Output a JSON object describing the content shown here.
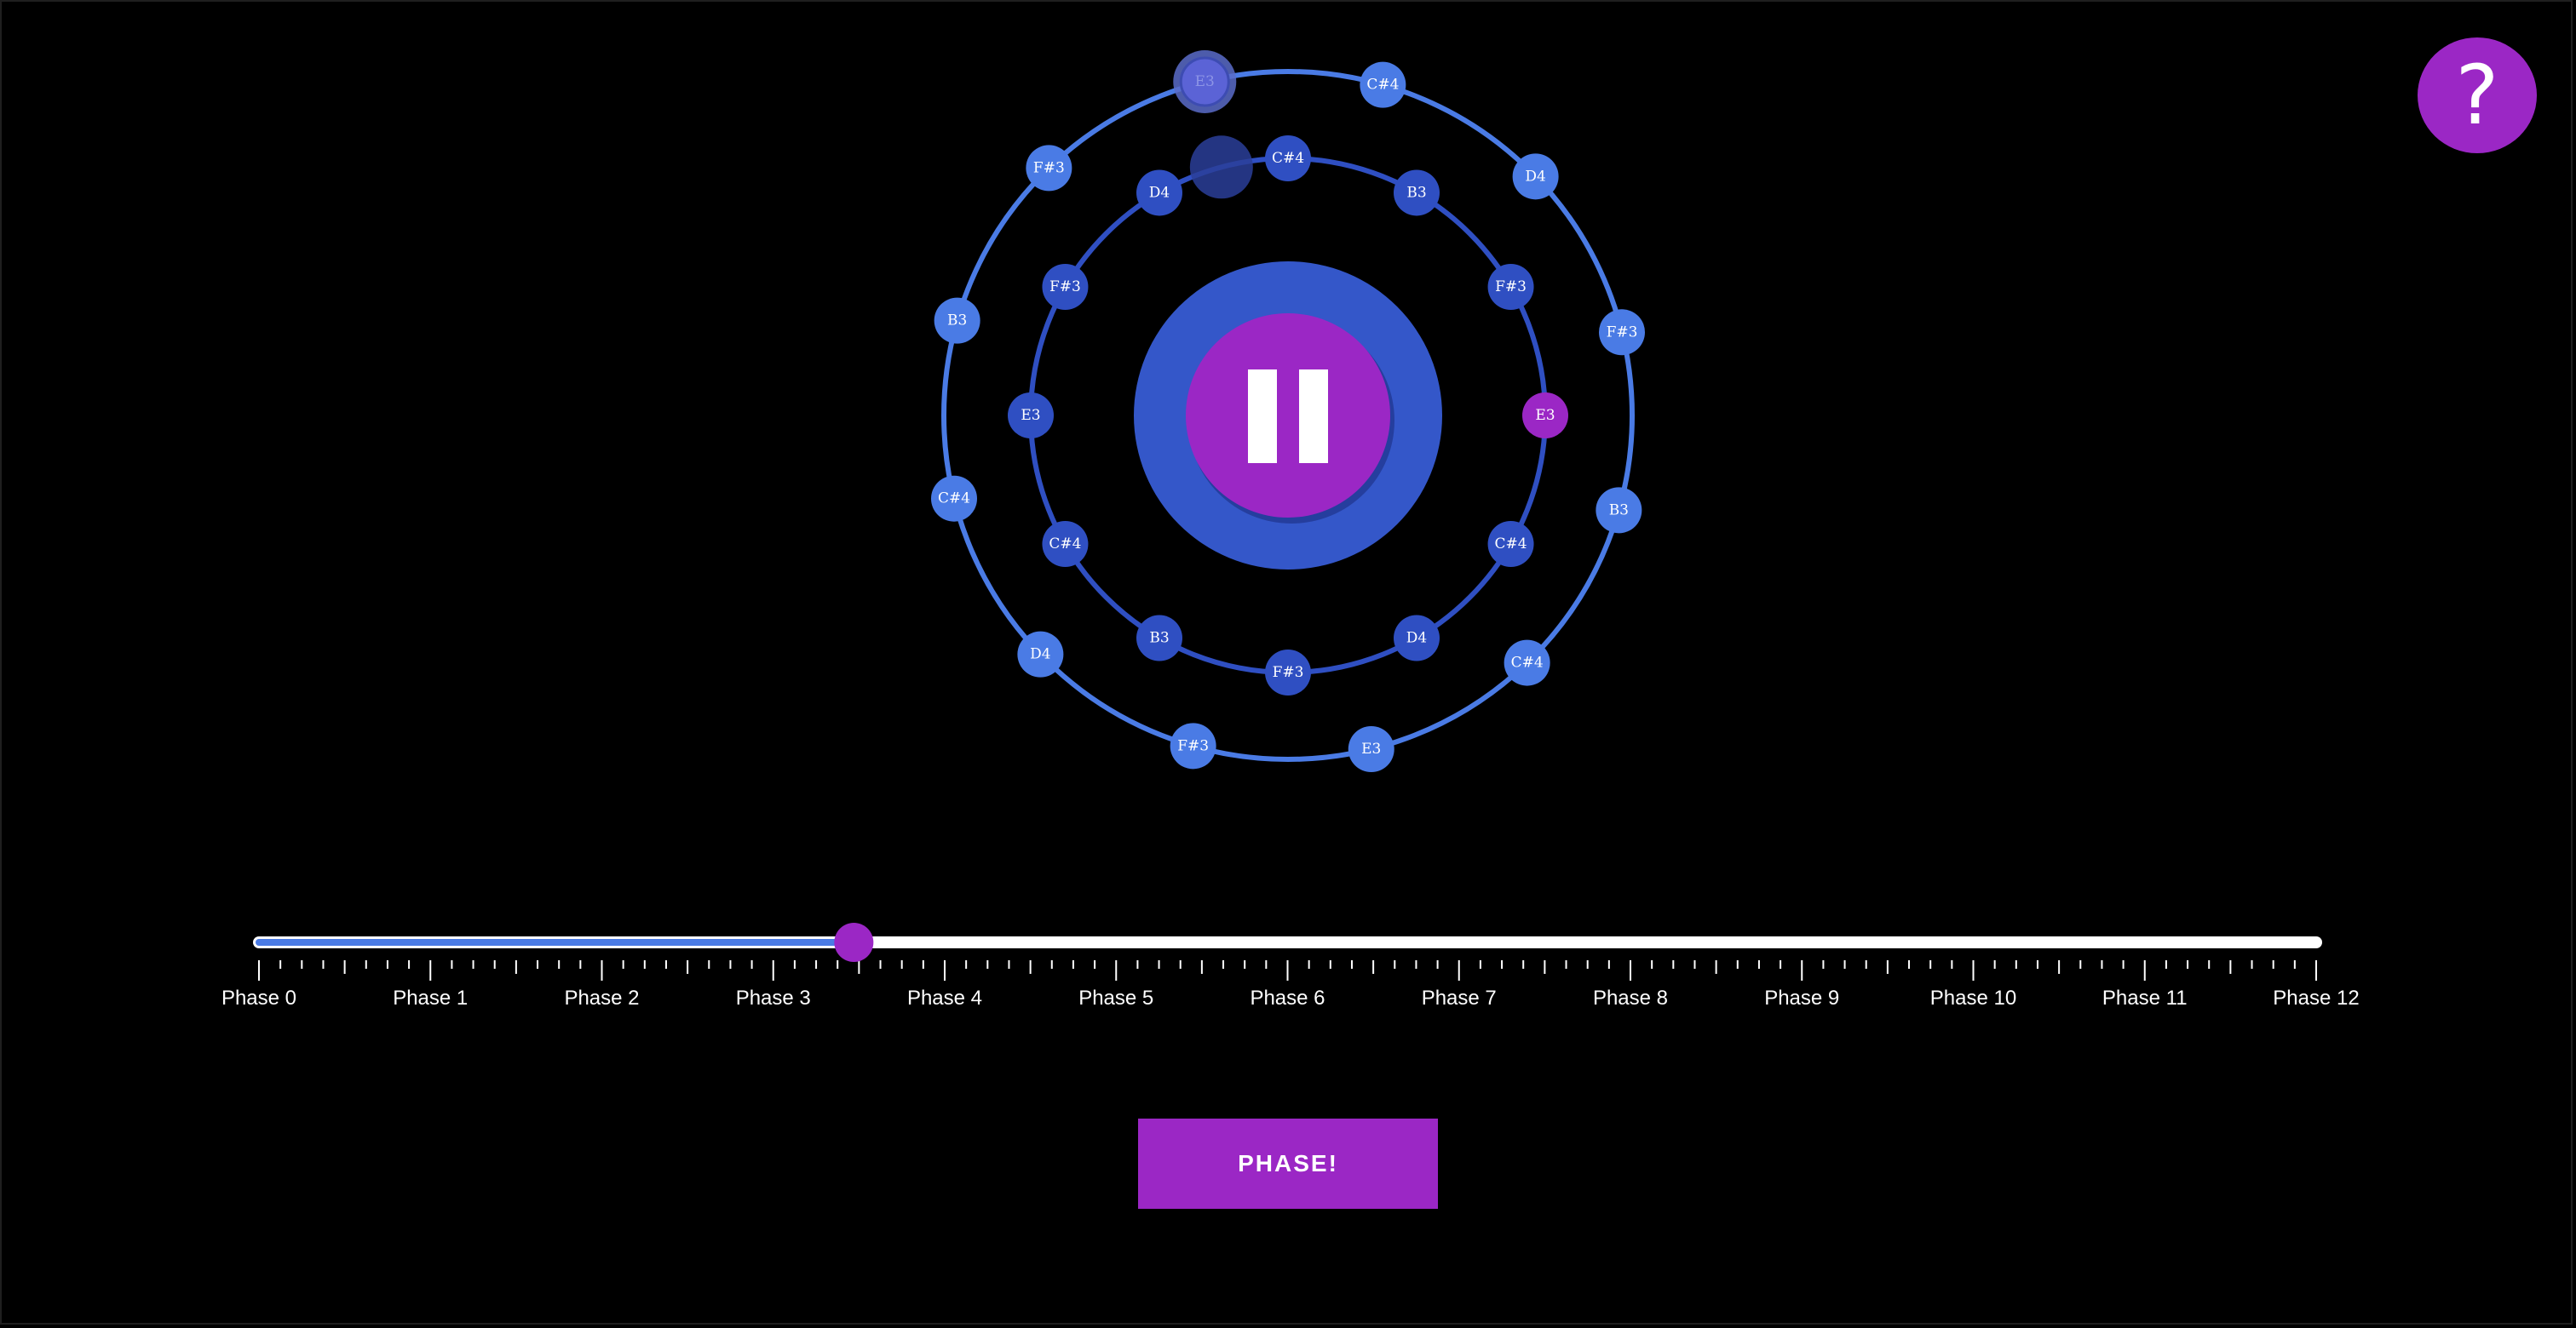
{
  "help_button": {
    "label": "?"
  },
  "outer_ring": {
    "notes": [
      "E3",
      "C#4",
      "D4",
      "F#3",
      "B3",
      "C#4",
      "E3",
      "F#3",
      "D4",
      "C#4",
      "B3",
      "F#3"
    ],
    "highlighted_index": 0
  },
  "inner_ring": {
    "notes": [
      "C#4",
      "B3",
      "F#3",
      "E3",
      "C#4",
      "D4",
      "F#3",
      "B3",
      "C#4",
      "E3",
      "F#3",
      "D4"
    ],
    "active_index": 3
  },
  "play_button": {
    "state": "playing",
    "icon": "pause-icon"
  },
  "phase_slider": {
    "value": 3.47,
    "min": 0,
    "max": 12,
    "labels": [
      "Phase 0",
      "Phase 1",
      "Phase 2",
      "Phase 3",
      "Phase 4",
      "Phase 5",
      "Phase 6",
      "Phase 7",
      "Phase 8",
      "Phase 9",
      "Phase 10",
      "Phase 11",
      "Phase 12"
    ]
  },
  "phase_button": {
    "label": "PHASE!"
  },
  "colors": {
    "background": "#000000",
    "accent_purple": "#9b27c5",
    "outer_blue": "#4a7be5",
    "inner_blue": "#2f4fc2",
    "center_blue": "#3457c9"
  }
}
